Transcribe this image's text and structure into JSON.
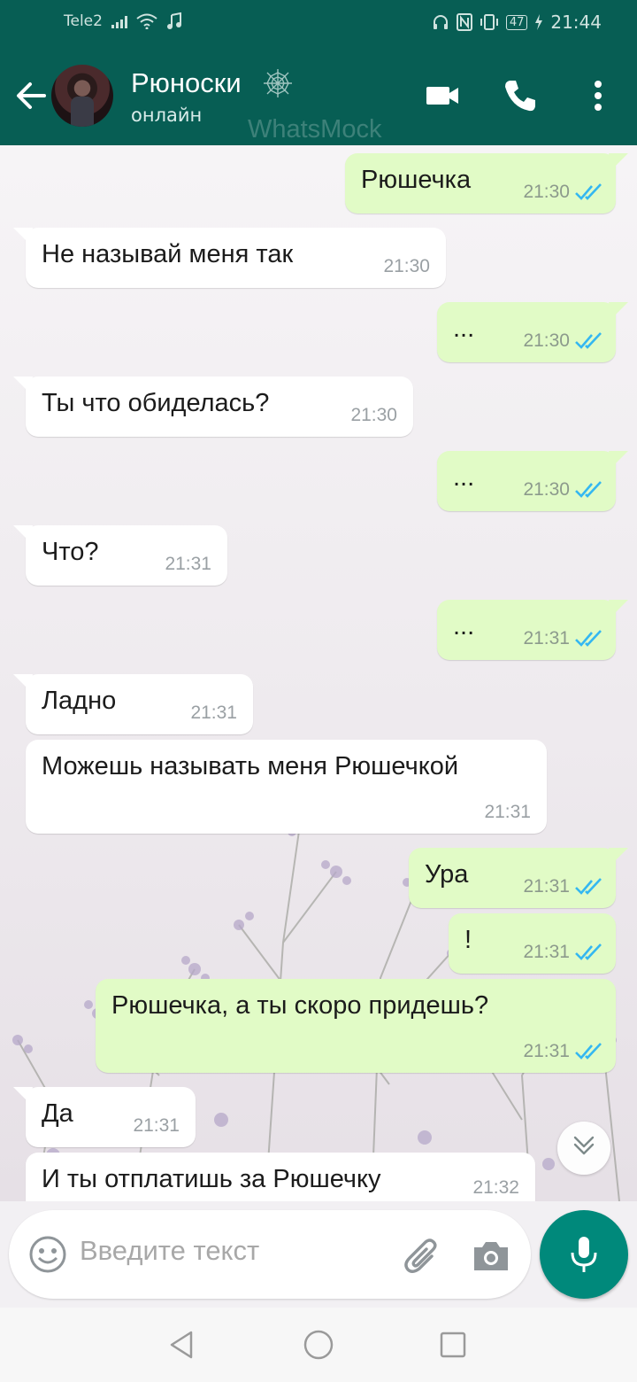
{
  "status_bar": {
    "carrier": "Tele2",
    "battery": "47",
    "time": "21:44"
  },
  "header": {
    "contact_name": "Рюноски",
    "status": "онлайн",
    "watermark": "WhatsMock"
  },
  "messages": [
    {
      "dir": "out",
      "text": "Рюшечка",
      "time": "21:30",
      "read": true
    },
    {
      "dir": "in",
      "text": "Не называй меня так",
      "time": "21:30"
    },
    {
      "dir": "out",
      "text": "...",
      "time": "21:30",
      "read": true
    },
    {
      "dir": "in",
      "text": "Ты что обиделась?",
      "time": "21:30"
    },
    {
      "dir": "out",
      "text": "...",
      "time": "21:30",
      "read": true
    },
    {
      "dir": "in",
      "text": "Что?",
      "time": "21:31"
    },
    {
      "dir": "out",
      "text": "...",
      "time": "21:31",
      "read": true
    },
    {
      "dir": "in",
      "text": "Ладно",
      "time": "21:31"
    },
    {
      "dir": "in",
      "text": "Можешь называть меня Рюшечкой",
      "time": "21:31"
    },
    {
      "dir": "out",
      "text": "Ура",
      "time": "21:31",
      "read": true
    },
    {
      "dir": "out",
      "text": "!",
      "time": "21:31",
      "read": true
    },
    {
      "dir": "out",
      "text": "Рюшечка, а ты скоро придешь?",
      "time": "21:31",
      "read": true
    },
    {
      "dir": "in",
      "text": "Да",
      "time": "21:31"
    },
    {
      "dir": "in",
      "text": "И ты отплатишь за Рюшечку",
      "time": "21:32"
    }
  ],
  "input": {
    "placeholder": "Введите текст"
  },
  "colors": {
    "header": "#075e54",
    "outgoing_bubble": "#e1fbc6",
    "incoming_bubble": "#ffffff",
    "read_ticks": "#34b7f1",
    "mic_button": "#00897b"
  },
  "icons": [
    "back-arrow-icon",
    "spider-web-icon",
    "video-call-icon",
    "phone-icon",
    "more-vert-icon",
    "emoji-icon",
    "attach-icon",
    "camera-icon",
    "mic-icon",
    "scroll-down-icon"
  ]
}
